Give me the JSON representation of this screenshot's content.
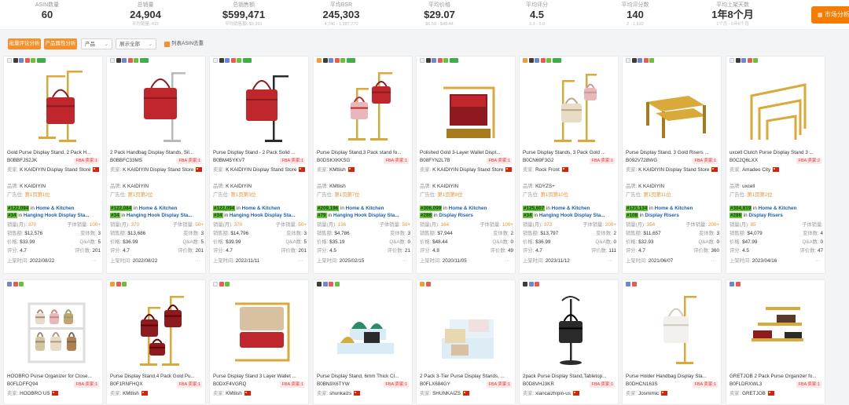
{
  "stats": [
    {
      "label": "ASIN数量",
      "value": "60",
      "sub": ""
    },
    {
      "label": "总销量",
      "value": "24,904",
      "sub": "平均销量: 415"
    },
    {
      "label": "总销售额",
      "value": "$599,471",
      "sub": "平均销售额: $9,991"
    },
    {
      "label": "平均BSR",
      "value": "245,303",
      "sub": "4,740 - 1,387,770"
    },
    {
      "label": "平均价格",
      "value": "$29.07",
      "sub": "$6.59 - $48.44"
    },
    {
      "label": "平均评分",
      "value": "4.5",
      "sub": "3.3 - 5.0"
    },
    {
      "label": "平均评分数",
      "value": "140",
      "sub": "2 - 1,632"
    },
    {
      "label": "平均上架天数",
      "value": "1年8个月",
      "sub": "1个月 - 6年6个月"
    }
  ],
  "market_button": {
    "icon": "chart-icon",
    "label": "市场分析"
  },
  "toolbar": {
    "btn_review": "批量评论分析",
    "btn_product": "产品属性分析",
    "select_product": "产品",
    "select_show": "展示全部",
    "checkbox_label": "列表ASIN去重"
  },
  "labels": {
    "seller": "卖家:",
    "brand": "品牌:",
    "ad": "广告位:",
    "fba": "FBA",
    "seller_count": "卖家:",
    "sales": "销量(月):",
    "child_sales": "子体销量:",
    "revenue": "销售额:",
    "variants": "变体数:",
    "price": "价格:",
    "qa": "Q&A数:",
    "rating": "评分:",
    "reviews": "评价数:",
    "listed": "上架时间:",
    "in": "in",
    "more": "···"
  },
  "products": [
    {
      "title": "Gold Purse Display Stand, 2 Pack H...",
      "asin": "B0BBFJS2JK",
      "seller_count": "1",
      "seller": "K KAIDIYIN Display Stand Store",
      "brand": "K KAIDIYIN",
      "ad": "第1页第1位",
      "rank1": "#122,094",
      "cat1": "Home & Kitchen",
      "rank2": "#34",
      "cat2": "Hanging Hook Display Sta...",
      "sales": "370",
      "child_sales": "100+",
      "revenue": "$12,576",
      "variants": "3",
      "price": "$33.99",
      "qa": "5",
      "rating": "4.7",
      "reviews": "201",
      "listed": "2022/08/22",
      "img": "gold-hanging-stand-red-bag"
    },
    {
      "title": "2 Pack Handbag Display Stands, Sil...",
      "asin": "B0BBFC33MS",
      "seller_count": "1",
      "seller": "K KAIDIYIN Display Stand Store",
      "brand": "K KAIDIYIN",
      "ad": "第1页第2位",
      "rank1": "#122,084",
      "cat1": "Home & Kitchen",
      "rank2": "#34",
      "cat2": "Hanging Hook Display Sta...",
      "sales": "370",
      "child_sales": "50+",
      "revenue": "$13,686",
      "variants": "3",
      "price": "$36.99",
      "qa": "5",
      "rating": "4.7",
      "reviews": "201",
      "listed": "2022/08/22",
      "img": "silver-hanging-stand-red-bag"
    },
    {
      "title": "Purse Display Stand - 2 Pack Solid ...",
      "asin": "B0BM45YKV7",
      "seller_count": "1",
      "seller": "K KAIDIYIN Display Stand Store",
      "brand": "K KAIDIYIN",
      "ad": "第1页第3位",
      "rank1": "#122,094",
      "cat1": "Home & Kitchen",
      "rank2": "#34",
      "cat2": "Hanging Hook Display Sta...",
      "sales": "370",
      "child_sales": "50+",
      "revenue": "$14,796",
      "variants": "3",
      "price": "$39.99",
      "qa": "5",
      "rating": "4.7",
      "reviews": "201",
      "listed": "2022/11/11",
      "img": "black-hanging-stand-red-bag"
    },
    {
      "title": "Purse Display Stand,3 Pack stand fo...",
      "asin": "B0DSKXKKSG",
      "seller_count": "1",
      "seller": "KMtlish",
      "brand": "KMtlish",
      "ad": "第1页第7位",
      "rank1": "#209,196",
      "cat1": "Home & Kitchen",
      "rank2": "#79",
      "cat2": "Hanging Hook Display Sta...",
      "sales": "136",
      "child_sales": "50+",
      "revenue": "$4,786",
      "variants": "3",
      "price": "$35.19",
      "qa": "0",
      "rating": "4.5",
      "reviews": "21",
      "listed": "2025/02/15",
      "img": "gold-stands-pink-bags"
    },
    {
      "title": "Polished Gold 3-Layer Wallet Displ...",
      "asin": "B08FYN2L7B",
      "seller_count": "1",
      "seller": "K KAIDIYIN Display Stand Store",
      "brand": "K KAIDIYIN",
      "ad": "第1页第8位",
      "rank1": "#306,099",
      "cat1": "Home & Kitchen",
      "rank2": "#286",
      "cat2": "Display Risers",
      "sales": "164",
      "child_sales": "100+",
      "revenue": "$7,944",
      "variants": "2",
      "price": "$48.44",
      "qa": "0",
      "rating": "4.8",
      "reviews": "49",
      "listed": "2020/11/05",
      "img": "gold-wallet-stand"
    },
    {
      "title": "Purse Display Stands, 3 Pack Gold ...",
      "asin": "B0CN69F3G2",
      "seller_count": "1",
      "seller": "Rock Front",
      "brand": "KDYZS+",
      "ad": "第1页第10位",
      "rank1": "#125,607",
      "cat1": "Home & Kitchen",
      "rank2": "#34",
      "cat2": "Hanging Hook Display Sta...",
      "sales": "373",
      "child_sales": "200+",
      "revenue": "$13,797",
      "variants": "2",
      "price": "$36.99",
      "qa": "0",
      "rating": "4.7",
      "reviews": "111",
      "listed": "2023/11/12",
      "img": "gold-stands-beige-bag"
    },
    {
      "title": "Purse Display Stand, 3 Gold Risers ...",
      "asin": "B092V728WG",
      "seller_count": "1",
      "seller": "K KAIDIYIN Display Stand Store",
      "brand": "K KAIDIYIN",
      "ad": "第1页第11位",
      "rank1": "#123,134",
      "cat1": "Home & Kitchen",
      "rank2": "#108",
      "cat2": "Display Risers",
      "sales": "354",
      "child_sales": "200+",
      "revenue": "$11,657",
      "variants": "3",
      "price": "$32.93",
      "qa": "0",
      "rating": "4.7",
      "reviews": "360",
      "listed": "2021/06/07",
      "img": "gold-risers"
    },
    {
      "title": "uxcell Clutch Purse Display Stand 3 ...",
      "asin": "B0C2Q6LXX",
      "seller_count": "2",
      "seller": "Amadeo City",
      "brand": "uxcell",
      "ad": "第1页第2位",
      "rank1": "#304,819",
      "cat1": "Home & Kitchen",
      "rank2": "#286",
      "cat2": "Display Risers",
      "sales": "85",
      "child_sales": "",
      "revenue": "$4,079",
      "variants": "4",
      "price": "$47.99",
      "qa": "0",
      "rating": "4.5",
      "reviews": "47",
      "listed": "2023/04/16",
      "img": "gold-wire-risers"
    },
    {
      "title": "HOOBRO Purse Organizer for Close...",
      "asin": "B0FLDFFQ94",
      "seller_count": "1",
      "seller": "HOOBRO US",
      "img": "white-shelf-organizer"
    },
    {
      "title": "Purse Display Stand,4 Pack Gold Pu...",
      "asin": "B0F1RNFHQX",
      "seller_count": "1",
      "seller": "KMtlish",
      "img": "gold-stands-burgundy-bags"
    },
    {
      "title": "Purse Display Stand 3 Layer Wallet ...",
      "asin": "B0DXF4VGRQ",
      "seller_count": "1",
      "seller": "KMtlish",
      "img": "gold-clutch-stand"
    },
    {
      "title": "Purse Display Stand, 6mm Thick Cl...",
      "asin": "B0BN9X6TYW",
      "seller_count": "1",
      "seller": "shunkaizs",
      "img": "acrylic-risers-shoes"
    },
    {
      "title": "2 Pack 3-Tier Purse Display Stands, ...",
      "asin": "B0FLX684GY",
      "seller_count": "1",
      "seller": "SHUNKAIZS",
      "img": "acrylic-tier-stands"
    },
    {
      "title": "2pack Purse Display Stand,Tabletop...",
      "asin": "B0D8VHJ3KR",
      "seller_count": "1",
      "seller": "xiancaizhipin-us",
      "img": "black-hook-stand"
    },
    {
      "title": "Purse Holder Handbag Display Sta...",
      "asin": "B0DHCN163S",
      "seller_count": "1",
      "seller": "Josmimic",
      "img": "gold-stand-white-bag"
    },
    {
      "title": "GRETJOB 2 Pack Purse Organizer fo...",
      "asin": "B0FLDRXWL3",
      "seller_count": "1",
      "seller": "GRETJOB",
      "img": "gold-tier-organizer"
    }
  ]
}
